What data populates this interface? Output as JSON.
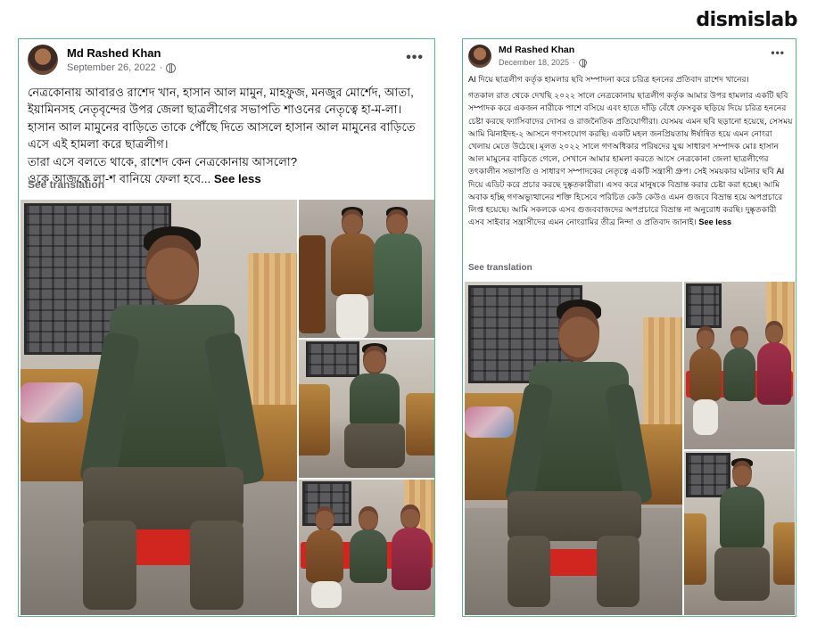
{
  "brand": {
    "logo_text": "dismislab"
  },
  "posts": [
    {
      "author": "Md Rashed Khan",
      "date": "September 26, 2022",
      "separator": "·",
      "more_label": "•••",
      "body_lines": [
        "নেত্রকোনায় আবারও রাশেদ খান, হাসান আল মামুন, মাহফুজ, মনজুর মোর্শেদ, আতা,",
        "ইয়ামিনসহ নেতৃবৃন্দের উপর জেলা ছাত্রলীগের সভাপতি শাওনের নেতৃত্বে হা-ম-লা।",
        "হাসান আল মামুনের বাড়িতে তাকে পৌঁছে দিতে আসলে হাসান আল মামুনের বাড়িতে",
        "এসে এই হামলা করে ছাত্রলীগ।",
        "তারা এসে বলতে থাকে, রাশেদ কেন নেত্রকোনায় আসলো?",
        "ওকে আজকে লা-শ বানিয়ে ফেলা হবে..."
      ],
      "see_less": "See less",
      "see_translation": "See translation"
    },
    {
      "author": "Md Rashed Khan",
      "date": "December 18, 2025",
      "separator": "·",
      "more_label": "•••",
      "intro": "AI দিয়ে ছাত্রলীগ কর্তৃক হামলার ছবি সম্পাদনা করে চরিত্র হননের প্রতিবাদ রাশেদ খানের।",
      "body": "গতকাল রাত থেকে দেখছি ২০২২ সালে নেত্রকোনায় ছাত্রলীগ কর্তৃক আমার উপর হামলার একটি ছবি সম্পাদক করে একজন নারীকে পাশে বসিয়ে এবং হাতে দাঁড়ি বেঁধে ফেসবুক ছড়িয়ে দিয়ে চরিত্র হননের চেষ্টা করছে ফ্যাসিবাদের দোসর ও রাজনৈতিক প্রতিযোগীরা। যেসময় এমন ছবি ছড়ানো হয়েছে, সেসময় আমি ঝিনাইদহ-২ আসনে গণসংযোগ করছি। একটি মহল জনপ্রিয়তায় ঈর্ষান্বিত হয়ে এমন নোংরা খেলায় মেতে উঠেছে। মূলত ২০২২ সালে গণঅধিকার পরিষদের যুগ্ম সাধারণ সম্পাদক মোঃ হাসান আল মামুনের বাড়িতে গেলে, সেখানে আমার হামলা করতে আসে নেত্রকোনা জেলা ছাত্রলীগের তৎকালীন সভাপতি ও সাধারণ সম্পাদকের নেতৃত্বে একটি সন্ত্রাসী গ্রুপ। সেই সময়কার ঘটনার ছবি AI দিয়ে এডিট করে প্রচার করছে দুষ্কৃতকারীরা। এসব করে মানুষকে বিভ্রান্ত করার চেষ্টা করা হচ্ছে। আমি অবাক হচ্ছি গণঅভ্যুত্থানের শক্তি হিসেবে পরিচিত কেউ কেউও এমন গুজবে বিভ্রান্ত হয়ে অপপ্রচারে লিপ্ত হয়েছে। আমি সকলকে এসব গুজববাজদের অপপ্রচারে বিভ্রান্ত না অনুরোধ করছি। দুষ্কৃতকারী এসব সাইবার সন্ত্রাসীদের এমন নোংরামির তীব্র নিন্দা ও প্রতিবাদ জানাই।",
      "see_less": "See less",
      "see_translation": "See translation"
    }
  ]
}
